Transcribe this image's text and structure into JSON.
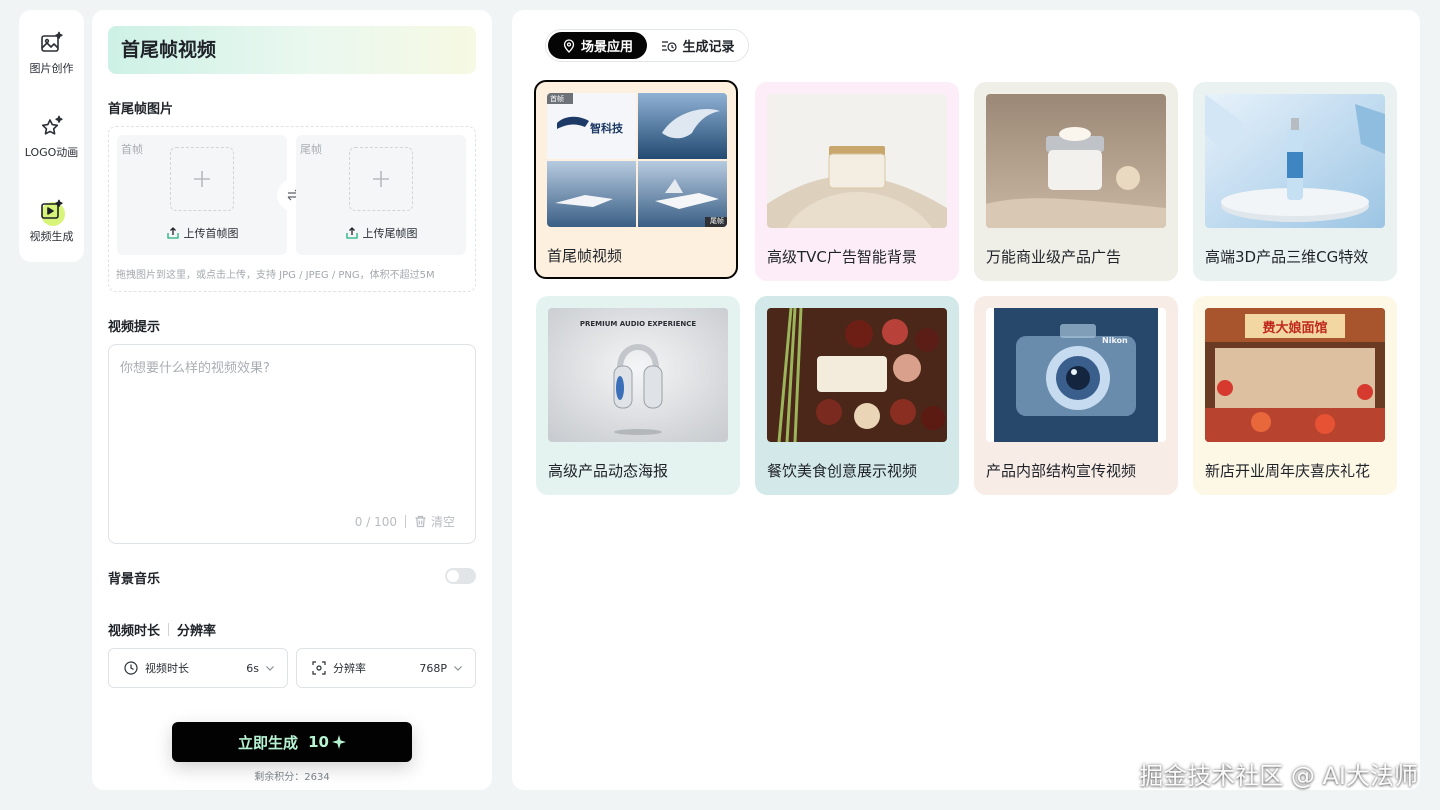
{
  "rail": {
    "items": [
      {
        "label": "图片创作",
        "icon": "image-sparkle-icon"
      },
      {
        "label": "LOGO动画",
        "icon": "star-sparkle-icon"
      },
      {
        "label": "视频生成",
        "icon": "video-sparkle-icon",
        "active": true
      }
    ]
  },
  "form": {
    "title": "首尾帧视频",
    "frames_label": "首尾帧图片",
    "first_frame": {
      "tag": "首帧",
      "upload_label": "上传首帧图"
    },
    "last_frame": {
      "tag": "尾帧",
      "upload_label": "上传尾帧图"
    },
    "upload_hint": "拖拽图片到这里，或点击上传，支持 JPG / JPEG / PNG，体积不超过5M",
    "prompt_label": "视频提示",
    "prompt_placeholder": "你想要什么样的视频效果?",
    "prompt_counter": "0 / 100",
    "clear_label": "清空",
    "music_label": "背景音乐",
    "music_enabled": false,
    "duration_header": "视频时长",
    "resolution_header": "分辨率",
    "duration_select": {
      "label": "视频时长",
      "value": "6s"
    },
    "resolution_select": {
      "label": "分辨率",
      "value": "768P"
    },
    "generate_label": "立即生成",
    "generate_cost": "10",
    "credits_text": "剩余积分：2634"
  },
  "main": {
    "tabs": [
      {
        "label": "场景应用",
        "icon": "location-pin-icon",
        "active": true
      },
      {
        "label": "生成记录",
        "icon": "history-list-icon",
        "active": false
      }
    ],
    "cards": [
      {
        "label": "首尾帧视频",
        "thumb_text": "智科技",
        "tag_first": "首帧",
        "tag_last": "尾帧",
        "selected": true,
        "bg": "#fdf0de"
      },
      {
        "label": "高级TVC广告智能背景",
        "bg": "#fcedf8"
      },
      {
        "label": "万能商业级产品广告",
        "bg": "#efefe8"
      },
      {
        "label": "高端3D产品三维CG特效",
        "bg": "#eaf2f1"
      },
      {
        "label": "高级产品动态海报",
        "thumb_text": "PREMIUM AUDIO EXPERIENCE",
        "bg": "#e5f3f0"
      },
      {
        "label": "餐饮美食创意展示视频",
        "bg": "#d3e9e9"
      },
      {
        "label": "产品内部结构宣传视频",
        "thumb_text": "Nikon",
        "bg": "#f8ece7"
      },
      {
        "label": "新店开业周年庆喜庆礼花",
        "thumb_text": "费大娘面馆",
        "bg": "#fdf7e6"
      }
    ]
  },
  "watermark": "掘金技术社区 @ AI大法师"
}
